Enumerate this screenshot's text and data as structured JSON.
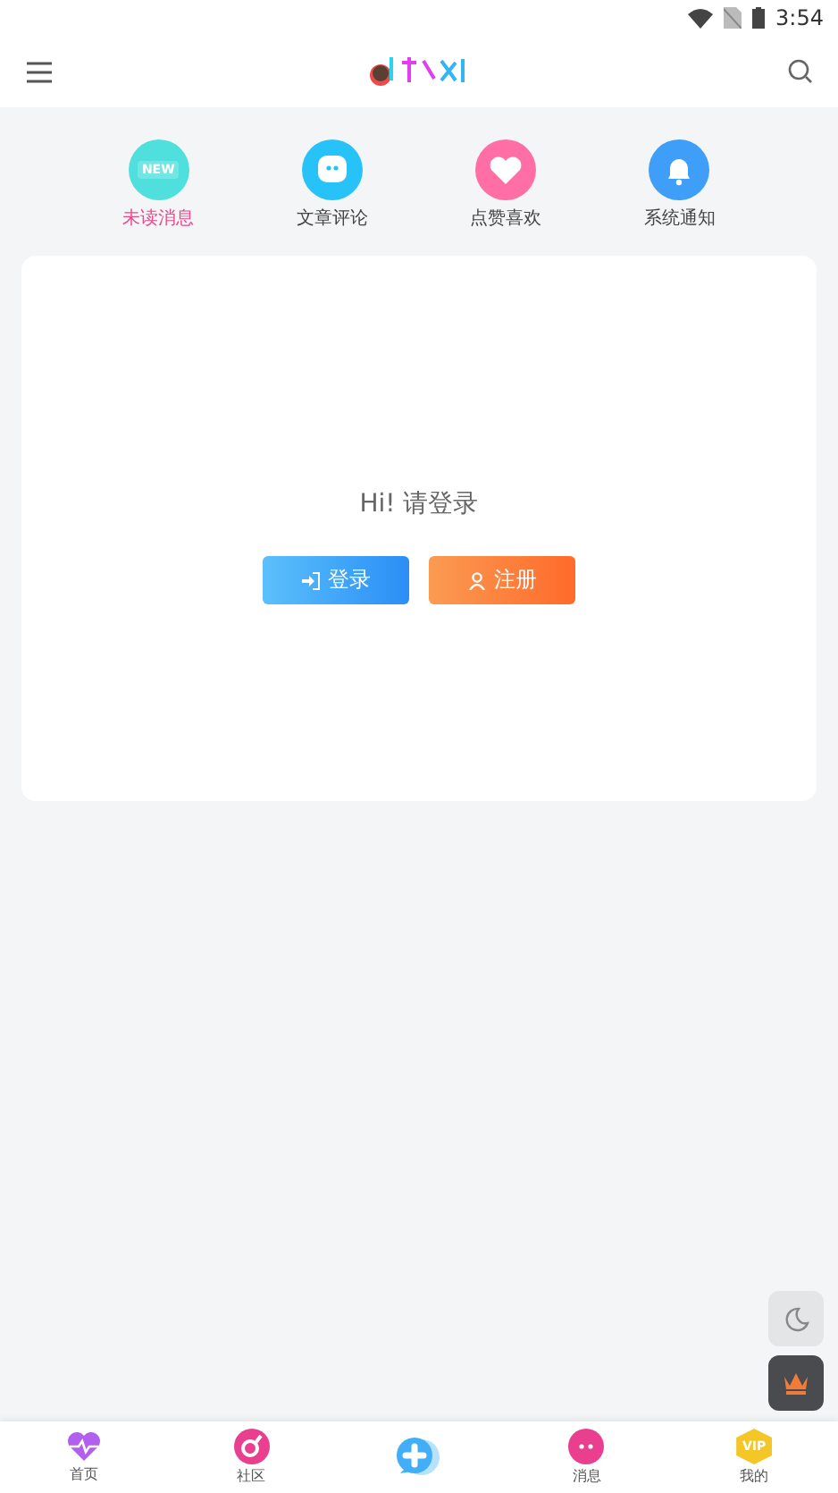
{
  "status_bar": {
    "time": "3:54"
  },
  "shortcuts": [
    {
      "kind": "new",
      "label": "未读消息",
      "badge": "NEW",
      "selected": true
    },
    {
      "kind": "comment",
      "label": "文章评论",
      "selected": false
    },
    {
      "kind": "heart",
      "label": "点赞喜欢",
      "selected": false
    },
    {
      "kind": "bell",
      "label": "系统通知",
      "selected": false
    }
  ],
  "login_card": {
    "greeting": "Hi!  请登录",
    "buttons": [
      {
        "kind": "login",
        "label": "登录"
      },
      {
        "kind": "register",
        "label": "注册"
      }
    ]
  },
  "bottom_nav": [
    {
      "kind": "home",
      "label": "首页"
    },
    {
      "kind": "community",
      "label": "社区"
    },
    {
      "kind": "add"
    },
    {
      "kind": "messages",
      "label": "消息"
    },
    {
      "kind": "vip",
      "label": "我的",
      "badge": "VIP"
    }
  ]
}
